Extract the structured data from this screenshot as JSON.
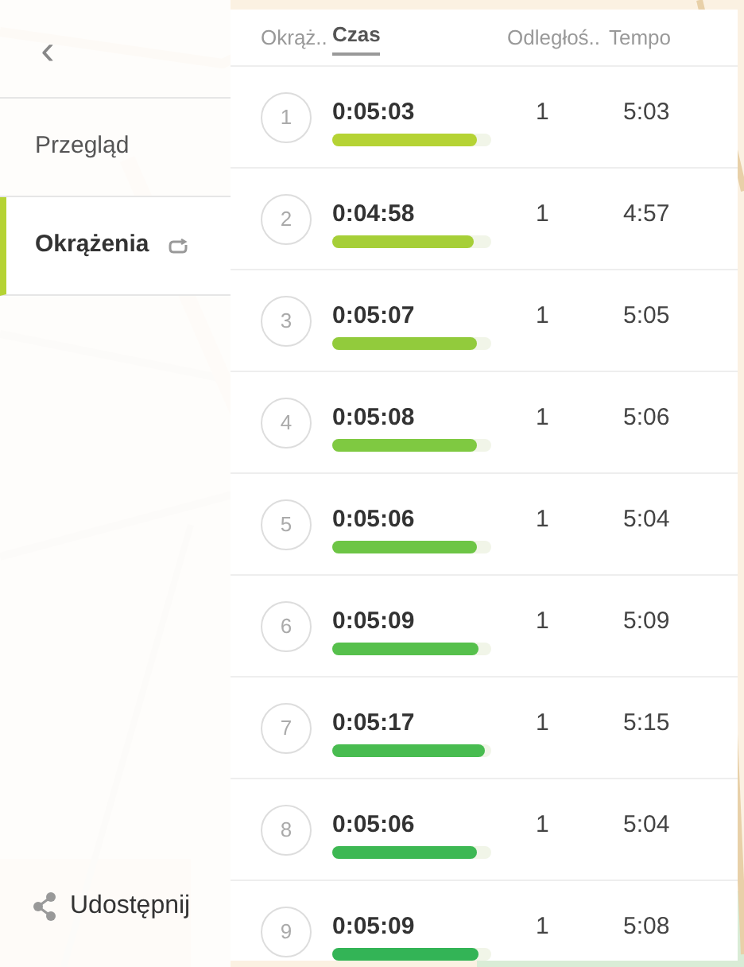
{
  "sidebar": {
    "back_button": "‹",
    "items": [
      {
        "label": "Przegląd",
        "selected": false,
        "kind": "plain"
      },
      {
        "label": "Okrążenia",
        "selected": true,
        "kind": "loop"
      }
    ],
    "share": {
      "label": "Udostępnij"
    }
  },
  "table": {
    "columns": [
      {
        "label": "Okrąż..",
        "sorted": false
      },
      {
        "label": "Czas",
        "sorted": true
      },
      {
        "label": "Odległoś..",
        "sorted": false
      },
      {
        "label": "Tempo",
        "sorted": false
      }
    ],
    "rows": [
      {
        "lap": "1",
        "time": "0:05:03",
        "level": 0.95,
        "color": "#b5d334",
        "distance": "1",
        "pace": "5:03"
      },
      {
        "lap": "2",
        "time": "0:04:58",
        "level": 0.93,
        "color": "#a6cf38",
        "distance": "1",
        "pace": "4:57"
      },
      {
        "lap": "3",
        "time": "0:05:07",
        "level": 0.95,
        "color": "#92cb3c",
        "distance": "1",
        "pace": "5:05"
      },
      {
        "lap": "4",
        "time": "0:05:08",
        "level": 0.95,
        "color": "#7fc941",
        "distance": "1",
        "pace": "5:06"
      },
      {
        "lap": "5",
        "time": "0:05:06",
        "level": 0.95,
        "color": "#6dc545",
        "distance": "1",
        "pace": "5:04"
      },
      {
        "lap": "6",
        "time": "0:05:09",
        "level": 0.96,
        "color": "#56c04c",
        "distance": "1",
        "pace": "5:09"
      },
      {
        "lap": "7",
        "time": "0:05:17",
        "level": 1.0,
        "color": "#48bc50",
        "distance": "1",
        "pace": "5:15"
      },
      {
        "lap": "8",
        "time": "0:05:06",
        "level": 0.95,
        "color": "#3db853",
        "distance": "1",
        "pace": "5:04"
      },
      {
        "lap": "9",
        "time": "0:05:09",
        "level": 0.96,
        "color": "#33b456",
        "distance": "1",
        "pace": "5:08"
      }
    ]
  }
}
